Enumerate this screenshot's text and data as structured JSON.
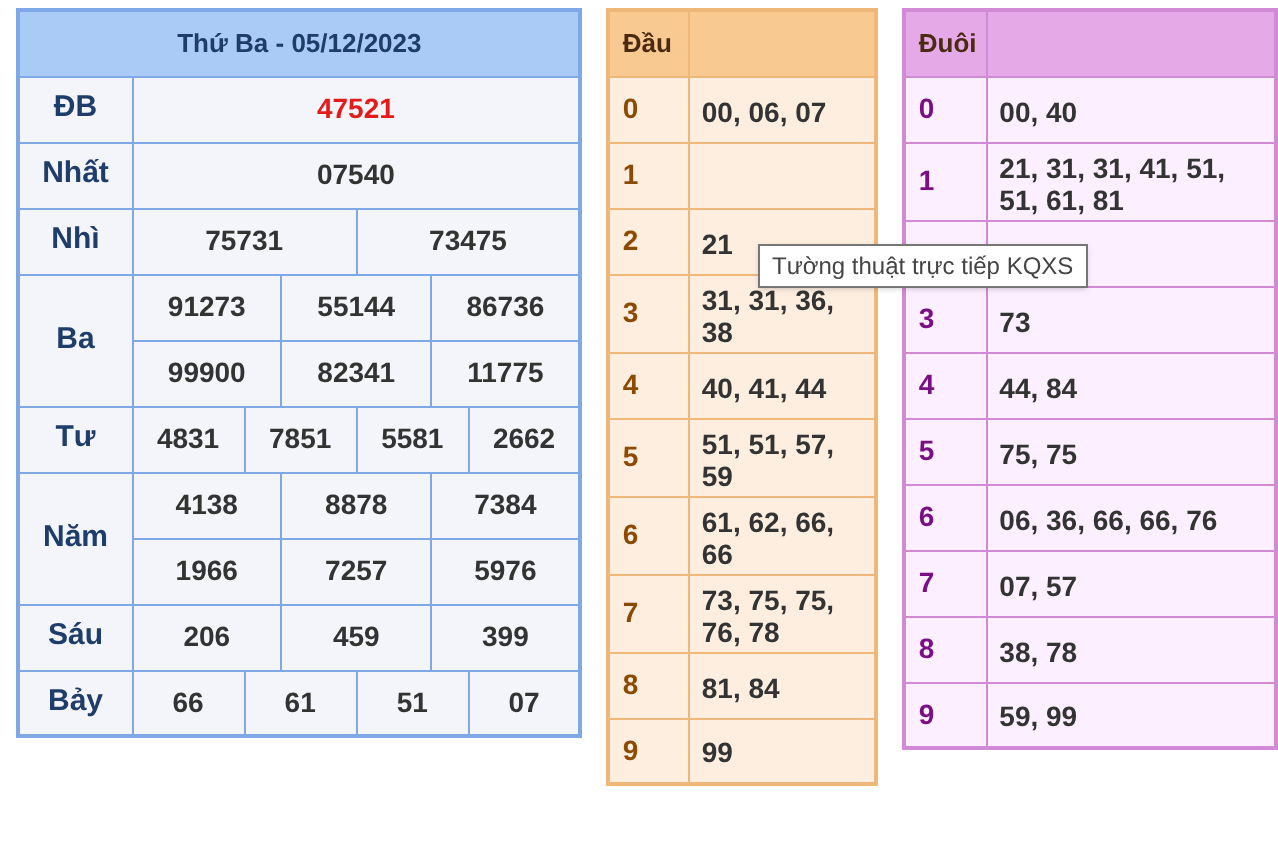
{
  "results": {
    "title": "Thứ Ba - 05/12/2023",
    "prizes": [
      {
        "name": "ĐB",
        "special": true,
        "rows": [
          [
            "47521"
          ]
        ]
      },
      {
        "name": "Nhất",
        "special": false,
        "rows": [
          [
            "07540"
          ]
        ]
      },
      {
        "name": "Nhì",
        "special": false,
        "rows": [
          [
            "75731",
            "73475"
          ]
        ]
      },
      {
        "name": "Ba",
        "special": false,
        "rows": [
          [
            "91273",
            "55144",
            "86736"
          ],
          [
            "99900",
            "82341",
            "11775"
          ]
        ]
      },
      {
        "name": "Tư",
        "special": false,
        "rows": [
          [
            "4831",
            "7851",
            "5581",
            "2662"
          ]
        ]
      },
      {
        "name": "Năm",
        "special": false,
        "rows": [
          [
            "4138",
            "8878",
            "7384"
          ],
          [
            "1966",
            "7257",
            "5976"
          ]
        ]
      },
      {
        "name": "Sáu",
        "special": false,
        "rows": [
          [
            "206",
            "459",
            "399"
          ]
        ]
      },
      {
        "name": "Bảy",
        "special": false,
        "rows": [
          [
            "66",
            "61",
            "51",
            "07"
          ]
        ]
      }
    ]
  },
  "dau": {
    "title": "Đầu",
    "rows": [
      {
        "digit": "0",
        "values": "00, 06, 07"
      },
      {
        "digit": "1"
      },
      {
        "digit": "2",
        "values": "21"
      },
      {
        "digit": "3",
        "values": "31, 31, 36, 38"
      },
      {
        "digit": "4",
        "values": "40, 41, 44"
      },
      {
        "digit": "5",
        "values": "51, 51, 57, 59"
      },
      {
        "digit": "6",
        "values": "61, 62, 66, 66"
      },
      {
        "digit": "7",
        "values": "73, 75, 75, 76, 78"
      },
      {
        "digit": "8",
        "values": "81, 84"
      },
      {
        "digit": "9",
        "values": "99"
      }
    ]
  },
  "duoi": {
    "title": "Đuôi",
    "rows": [
      {
        "digit": "0",
        "values": "00, 40"
      },
      {
        "digit": "1",
        "values": "21, 31, 31, 41, 51, 51, 61, 81"
      },
      {},
      {
        "digit": "3",
        "values": "73"
      },
      {
        "digit": "4",
        "values": "44, 84"
      },
      {
        "digit": "5",
        "values": "75, 75"
      },
      {
        "digit": "6",
        "values": "06, 36, 66, 66, 76"
      },
      {
        "digit": "7",
        "values": "07, 57"
      },
      {
        "digit": "8",
        "values": "38, 78"
      },
      {
        "digit": "9",
        "values": "59, 99"
      }
    ]
  },
  "tooltip": "Tường thuật trực tiếp KQXS"
}
